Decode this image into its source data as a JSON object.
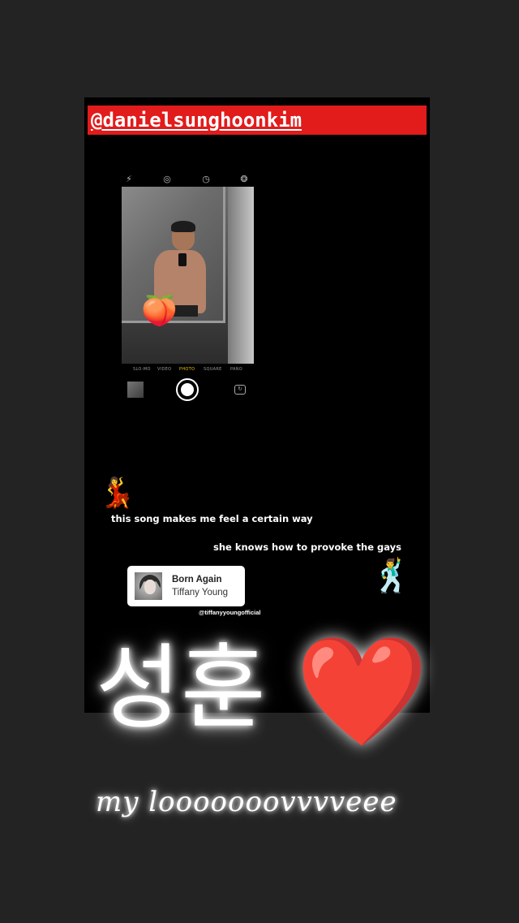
{
  "story": {
    "mention": "@danielsunghoonkim",
    "camera": {
      "top_icons": [
        "flash-off-icon",
        "live-photo-icon",
        "timer-icon",
        "filters-icon"
      ],
      "modes": [
        "SLO-MO",
        "VIDEO",
        "PHOTO",
        "SQUARE",
        "PANO"
      ],
      "active_mode": "PHOTO"
    },
    "stickers": {
      "peach": "🍑",
      "dancer_woman": "💃",
      "dancer_man": "🕺"
    },
    "captions": {
      "line1": "this song makes me feel a certain way",
      "line2": "she knows how to provoke the gays"
    },
    "music": {
      "title": "Born Again",
      "artist": "Tiffany Young",
      "handle": "@tiffanyyoungofficial"
    },
    "overlay": {
      "korean_text": "성훈",
      "heart": "❤️",
      "script_text": "my looooooovvvveee"
    }
  },
  "colors": {
    "background": "#232323",
    "story_bg": "#000000",
    "mention_bg": "#e21b1b",
    "heart": "#e8141b",
    "active_mode": "#f2c200"
  }
}
